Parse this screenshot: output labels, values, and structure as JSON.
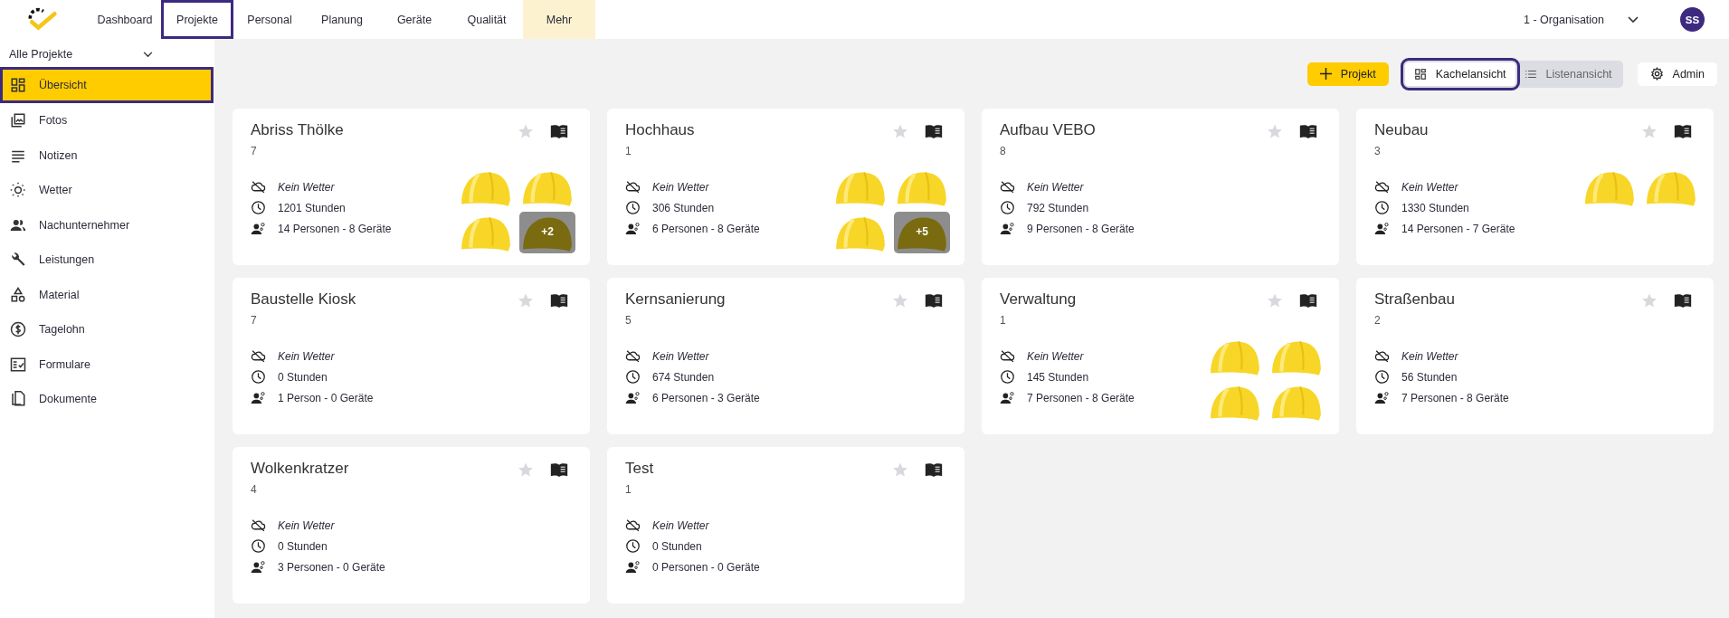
{
  "nav": {
    "tabs": [
      {
        "label": "Dashboard",
        "selected": false,
        "kind": "tab"
      },
      {
        "label": "Projekte",
        "selected": true,
        "kind": "tab"
      },
      {
        "label": "Personal",
        "selected": false,
        "kind": "tab"
      },
      {
        "label": "Planung",
        "selected": false,
        "kind": "tab"
      },
      {
        "label": "Geräte",
        "selected": false,
        "kind": "tab"
      },
      {
        "label": "Qualität",
        "selected": false,
        "kind": "tab"
      },
      {
        "label": "Mehr",
        "selected": false,
        "kind": "more"
      }
    ],
    "organisation": "1 - Organisation",
    "avatar": "SS"
  },
  "sidebar": {
    "filter": "Alle Projekte",
    "items": [
      {
        "label": "Übersicht",
        "selected": true
      },
      {
        "label": "Fotos",
        "selected": false
      },
      {
        "label": "Notizen",
        "selected": false
      },
      {
        "label": "Wetter",
        "selected": false
      },
      {
        "label": "Nachunternehmer",
        "selected": false
      },
      {
        "label": "Leistungen",
        "selected": false
      },
      {
        "label": "Material",
        "selected": false
      },
      {
        "label": "Tagelohn",
        "selected": false
      },
      {
        "label": "Formulare",
        "selected": false
      },
      {
        "label": "Dokumente",
        "selected": false
      }
    ]
  },
  "toolbar": {
    "new_button": "Projekt",
    "views": [
      {
        "label": "Kachelansicht",
        "selected": true
      },
      {
        "label": "Listenansicht",
        "selected": false
      }
    ],
    "admin_button": "Admin"
  },
  "projects": [
    {
      "name": "Abriss Thölke",
      "number": "7",
      "weather": "Kein Wetter",
      "hours": "1201 Stunden",
      "staff": "14 Personen - 8 Geräte",
      "favorite": false,
      "avatars": [
        {
          "kind": "helmet"
        },
        {
          "kind": "helmet"
        },
        {
          "kind": "helmet"
        },
        {
          "kind": "more",
          "label": "+2"
        }
      ]
    },
    {
      "name": "Hochhaus",
      "number": "1",
      "weather": "Kein Wetter",
      "hours": "306 Stunden",
      "staff": "6 Personen - 8 Geräte",
      "favorite": false,
      "avatars": [
        {
          "kind": "helmet"
        },
        {
          "kind": "helmet"
        },
        {
          "kind": "helmet"
        },
        {
          "kind": "more",
          "label": "+5"
        }
      ]
    },
    {
      "name": "Aufbau VEBO",
      "number": "8",
      "weather": "Kein Wetter",
      "hours": "792 Stunden",
      "staff": "9 Personen - 8 Geräte",
      "favorite": false
    },
    {
      "name": "Neubau",
      "number": "3",
      "weather": "Kein Wetter",
      "hours": "1330 Stunden",
      "staff": "14 Personen - 7 Geräte",
      "favorite": false,
      "avatars": [
        {
          "kind": "helmet"
        },
        {
          "kind": "helmet"
        }
      ]
    },
    {
      "name": "Baustelle Kiosk",
      "number": "7",
      "weather": "Kein Wetter",
      "hours": "0 Stunden",
      "staff": "1 Person - 0 Geräte",
      "favorite": false
    },
    {
      "name": "Kernsanierung",
      "number": "5",
      "weather": "Kein Wetter",
      "hours": "674 Stunden",
      "staff": "6 Personen - 3 Geräte",
      "favorite": false
    },
    {
      "name": "Verwaltung",
      "number": "1",
      "weather": "Kein Wetter",
      "hours": "145 Stunden",
      "staff": "7 Personen - 8 Geräte",
      "favorite": false,
      "avatars": [
        {
          "kind": "helmet"
        },
        {
          "kind": "helmet"
        },
        {
          "kind": "helmet"
        },
        {
          "kind": "helmet"
        }
      ]
    },
    {
      "name": "Straßenbau",
      "number": "2",
      "weather": "Kein Wetter",
      "hours": "56 Stunden",
      "staff": "7 Personen - 8 Geräte",
      "favorite": false
    },
    {
      "name": "Wolkenkratzer",
      "number": "4",
      "weather": "Kein Wetter",
      "hours": "0 Stunden",
      "staff": "3 Personen - 0 Geräte",
      "favorite": false
    },
    {
      "name": "Test",
      "number": "1",
      "weather": "Kein Wetter",
      "hours": "0 Stunden",
      "staff": "0 Personen - 0 Geräte",
      "favorite": false
    }
  ]
}
